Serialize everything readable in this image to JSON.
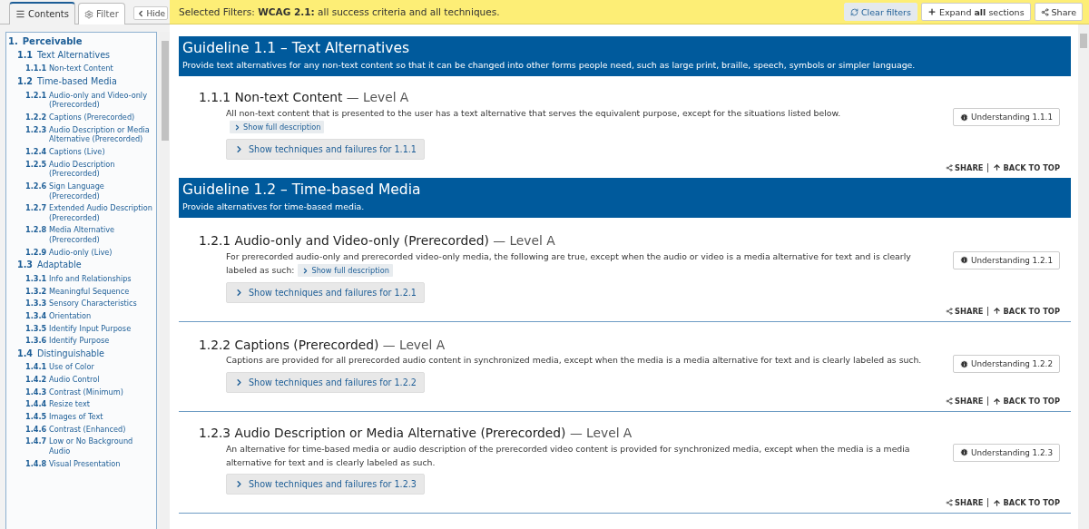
{
  "sidebar": {
    "tabs": [
      {
        "label": "Contents",
        "kind": "contents",
        "selected": true
      },
      {
        "label": "Filter",
        "kind": "filter",
        "selected": false
      }
    ],
    "hide_button": "Hide",
    "toc": [
      {
        "number": "1.",
        "label": "Perceivable",
        "children": [
          {
            "number": "1.1",
            "label": "Text Alternatives",
            "children": [
              {
                "number": "1.1.1",
                "label": "Non-text Content"
              }
            ]
          },
          {
            "number": "1.2",
            "label": "Time-based Media",
            "children": [
              {
                "number": "1.2.1",
                "label": "Audio-only and Video-only (Prerecorded)"
              },
              {
                "number": "1.2.2",
                "label": "Captions (Prerecorded)"
              },
              {
                "number": "1.2.3",
                "label": "Audio Description or Media Alternative (Prerecorded)"
              },
              {
                "number": "1.2.4",
                "label": "Captions (Live)"
              },
              {
                "number": "1.2.5",
                "label": "Audio Description (Prerecorded)"
              },
              {
                "number": "1.2.6",
                "label": "Sign Language (Prerecorded)"
              },
              {
                "number": "1.2.7",
                "label": "Extended Audio Description (Prerecorded)"
              },
              {
                "number": "1.2.8",
                "label": "Media Alternative (Prerecorded)"
              },
              {
                "number": "1.2.9",
                "label": "Audio-only (Live)"
              }
            ]
          },
          {
            "number": "1.3",
            "label": "Adaptable",
            "children": [
              {
                "number": "1.3.1",
                "label": "Info and Relationships"
              },
              {
                "number": "1.3.2",
                "label": "Meaningful Sequence"
              },
              {
                "number": "1.3.3",
                "label": "Sensory Characteristics"
              },
              {
                "number": "1.3.4",
                "label": "Orientation"
              },
              {
                "number": "1.3.5",
                "label": "Identify Input Purpose"
              },
              {
                "number": "1.3.6",
                "label": "Identify Purpose"
              }
            ]
          },
          {
            "number": "1.4",
            "label": "Distinguishable",
            "children": [
              {
                "number": "1.4.1",
                "label": "Use of Color"
              },
              {
                "number": "1.4.2",
                "label": "Audio Control"
              },
              {
                "number": "1.4.3",
                "label": "Contrast (Minimum)"
              },
              {
                "number": "1.4.4",
                "label": "Resize text"
              },
              {
                "number": "1.4.5",
                "label": "Images of Text"
              },
              {
                "number": "1.4.6",
                "label": "Contrast (Enhanced)"
              },
              {
                "number": "1.4.7",
                "label": "Low or No Background Audio"
              },
              {
                "number": "1.4.8",
                "label": "Visual Presentation"
              }
            ]
          }
        ]
      }
    ]
  },
  "filter_bar": {
    "text": "Selected Filters: **WCAG 2.1:** all success criteria and all techniques.",
    "buttons": [
      {
        "label": "Clear filters",
        "kind": "clear",
        "selected": true
      },
      {
        "label": "Expand **all** sections",
        "kind": "expand",
        "selected": false
      },
      {
        "label": "Share",
        "kind": "share",
        "selected": false
      }
    ]
  },
  "guidelines": [
    {
      "title": "Guideline 1.1 – Text Alternatives",
      "description": "Provide text alternatives for any non-text content so that it can be changed into other forms people need, such as large print, braille, speech, symbols or simpler language.",
      "criteria": [
        {
          "title": "1.1.1 Non-text Content",
          "level": "— Level A",
          "description": "All non-text content that is presented to the user has a text alternative that serves the equivalent purpose, except for the situations listed below.",
          "full_description": "Show full description",
          "understanding": "Understanding 1.1.1",
          "techniques": "Show techniques and failures for 1.1.1",
          "share": "SHARE",
          "back_to_top": "BACK TO TOP"
        }
      ]
    },
    {
      "title": "Guideline 1.2 – Time-based Media",
      "description": "Provide alternatives for time-based media.",
      "criteria": [
        {
          "title": "1.2.1 Audio-only and Video-only (Prerecorded)",
          "level": "— Level A",
          "description": "For prerecorded audio-only and prerecorded video-only media, the following are true, except when the audio or video is a media alternative for text and is clearly labeled as such:",
          "full_description": "Show full description",
          "understanding": "Understanding 1.2.1",
          "techniques": "Show techniques and failures for 1.2.1",
          "share": "SHARE",
          "back_to_top": "BACK TO TOP"
        },
        {
          "title": "1.2.2 Captions (Prerecorded)",
          "level": "— Level A",
          "description": "Captions are provided for all prerecorded audio content in synchronized media, except when the media is a media alternative for text and is clearly labeled as such.",
          "understanding": "Understanding 1.2.2",
          "techniques": "Show techniques and failures for 1.2.2",
          "share": "SHARE",
          "back_to_top": "BACK TO TOP"
        },
        {
          "title": "1.2.3 Audio Description or Media Alternative (Prerecorded)",
          "level": "— Level A",
          "description": "An alternative for time-based media or audio description of the prerecorded video content is provided for synchronized media, except when the media is a media alternative for text and is clearly labeled as such.",
          "understanding": "Understanding 1.2.3",
          "techniques": "Show techniques and failures for 1.2.3",
          "share": "SHARE",
          "back_to_top": "BACK TO TOP"
        }
      ]
    }
  ]
}
